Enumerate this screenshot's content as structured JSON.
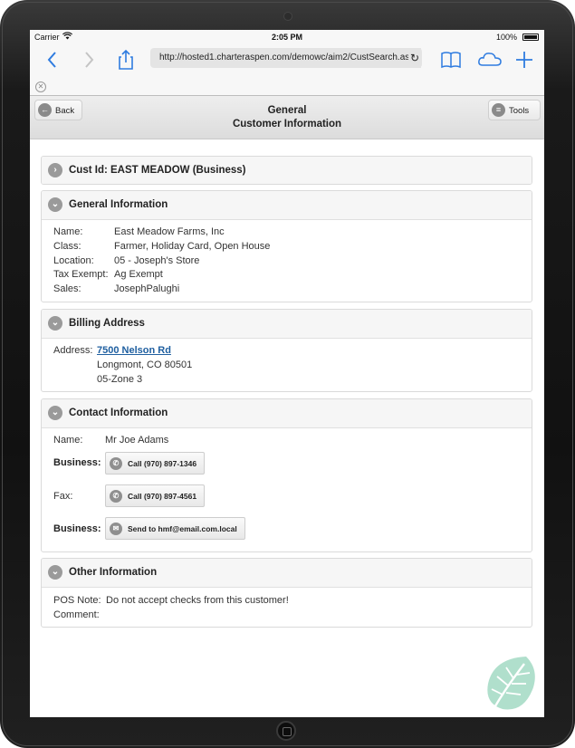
{
  "status_bar": {
    "carrier": "Carrier",
    "time": "2:05 PM",
    "battery": "100%"
  },
  "browser": {
    "url": "http://hosted1.charteraspen.com/demowc/aim2/CustSearch.as",
    "icons": [
      "back-icon",
      "forward-icon",
      "share-icon",
      "bookmarks-icon",
      "cloud-tabs-icon",
      "new-tab-icon"
    ]
  },
  "header": {
    "back_label": "Back",
    "title_line1": "General",
    "title_line2": "Customer Information",
    "tools_label": "Tools"
  },
  "cust_panel": {
    "title": "Cust Id: EAST MEADOW (Business)"
  },
  "general": {
    "title": "General Information",
    "rows": [
      {
        "label": "Name:",
        "value": "East Meadow Farms, Inc"
      },
      {
        "label": "Class:",
        "value": "Farmer, Holiday Card, Open House"
      },
      {
        "label": "Location:",
        "value": "05 - Joseph's Store"
      },
      {
        "label": "Tax Exempt:",
        "value": "Ag Exempt"
      },
      {
        "label": "Sales:",
        "value": "JosephPalughi"
      }
    ]
  },
  "billing": {
    "title": "Billing Address",
    "label": "Address:",
    "street": "7500 Nelson Rd",
    "city": "Longmont, CO 80501",
    "zone": "05-Zone 3"
  },
  "contact": {
    "title": "Contact Information",
    "name_label": "Name:",
    "name_value": "Mr Joe Adams",
    "business_label": "Business:",
    "business_call": "Call (970) 897-1346",
    "fax_label": "Fax:",
    "fax_call": "Call (970) 897-4561",
    "email_label": "Business:",
    "email_action": "Send to hmf@email.com.local"
  },
  "other": {
    "title": "Other Information",
    "pos_label": "POS Note:",
    "pos_value": "Do not accept checks from this customer!",
    "comment_label": "Comment:"
  },
  "colors": {
    "link": "#1f5fa0",
    "ios_blue": "#2f7ce0",
    "leaf": "#a7dcc6"
  }
}
